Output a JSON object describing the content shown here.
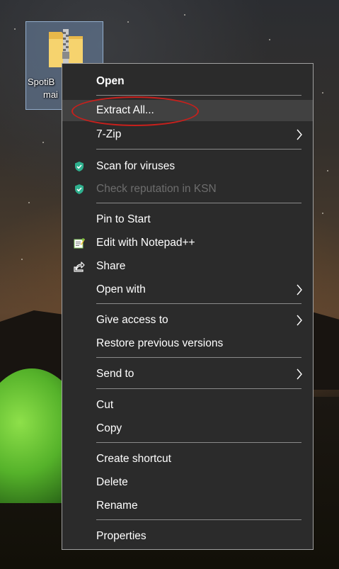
{
  "desktop": {
    "icon": {
      "name_line1": "SpotiB",
      "name_line2": "mai"
    }
  },
  "context_menu": {
    "open": "Open",
    "extract_all": "Extract All...",
    "seven_zip": "7-Zip",
    "scan_for_viruses": "Scan for viruses",
    "check_reputation": "Check reputation in KSN",
    "pin_to_start": "Pin to Start",
    "edit_with_notepad": "Edit with Notepad++",
    "share": "Share",
    "open_with": "Open with",
    "give_access_to": "Give access to",
    "restore_previous_versions": "Restore previous versions",
    "send_to": "Send to",
    "cut": "Cut",
    "copy": "Copy",
    "create_shortcut": "Create shortcut",
    "delete": "Delete",
    "rename": "Rename",
    "properties": "Properties"
  },
  "colors": {
    "menu_bg": "#2b2b2b",
    "highlight": "#414141",
    "annotation": "#c8201c",
    "kaspersky_green": "#2fb08e"
  }
}
